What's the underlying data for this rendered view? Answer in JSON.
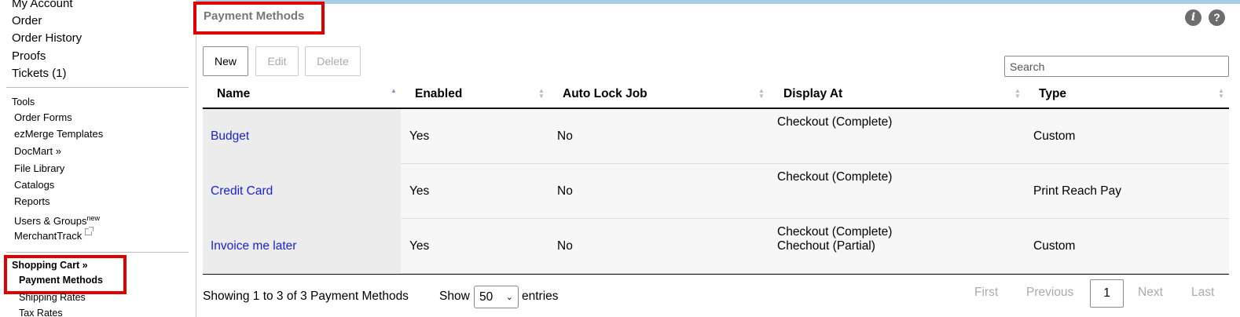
{
  "sidebar": {
    "account_items": [
      "My Account",
      "Order",
      "Order History",
      "Proofs",
      "Tickets (1)"
    ],
    "tools_heading": "Tools",
    "tools": [
      {
        "label": "Order Forms"
      },
      {
        "label": "ezMerge Templates"
      },
      {
        "label": "DocMart »"
      },
      {
        "label": "File Library"
      },
      {
        "label": "Catalogs"
      },
      {
        "label": "Reports"
      },
      {
        "label": "Users & Groups",
        "badge": "new"
      },
      {
        "label": "MerchantTrack",
        "icon": "external-link-icon"
      }
    ],
    "cart_heading": "Shopping Cart »",
    "cart_items": [
      "Payment Methods",
      "Shipping Rates",
      "Tax Rates"
    ]
  },
  "header": {
    "title": "Payment Methods",
    "info_icon": "i",
    "help_icon": "?",
    "accent_color": "#a9cde6",
    "highlight_color": "#e10000"
  },
  "toolbar": {
    "new_label": "New",
    "edit_label": "Edit",
    "delete_label": "Delete",
    "search_placeholder": "Search"
  },
  "table": {
    "columns": [
      "Name",
      "Enabled",
      "Auto Lock Job",
      "Display At",
      "Type"
    ],
    "sort_column": "Name",
    "rows": [
      {
        "name": "Budget",
        "enabled": "Yes",
        "auto_lock": "No",
        "display_at": [
          "Checkout (Complete)"
        ],
        "type": "Custom"
      },
      {
        "name": "Credit Card",
        "enabled": "Yes",
        "auto_lock": "No",
        "display_at": [
          "Checkout (Complete)"
        ],
        "type": "Print Reach Pay"
      },
      {
        "name": "Invoice me later",
        "enabled": "Yes",
        "auto_lock": "No",
        "display_at": [
          "Checkout (Complete)",
          "Chechout (Partial)"
        ],
        "type": "Custom"
      }
    ]
  },
  "footer": {
    "info": "Showing 1 to 3 of 3 Payment Methods",
    "show_label": "Show",
    "page_size": "50",
    "entries_label": "entries",
    "pagination": {
      "first": "First",
      "previous": "Previous",
      "current": "1",
      "next": "Next",
      "last": "Last"
    }
  }
}
